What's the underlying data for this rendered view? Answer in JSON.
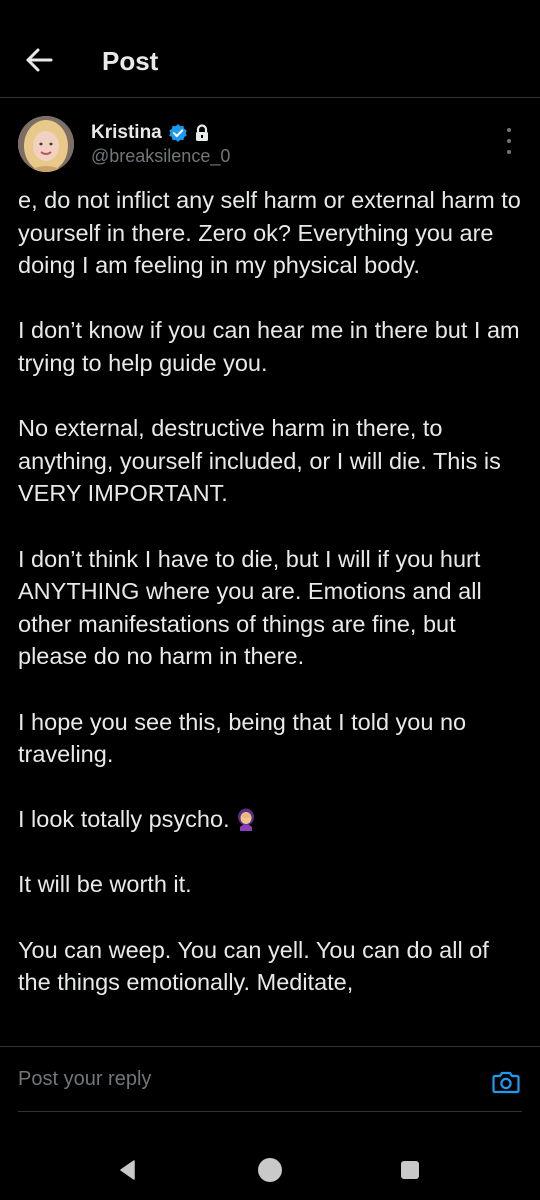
{
  "header": {
    "title": "Post",
    "back_icon": "arrow-left-icon"
  },
  "author": {
    "name": "Kristina",
    "handle": "@breaksilence_0",
    "verified_icon": "verified-badge-icon",
    "lock_icon": "lock-icon",
    "more_icon": "more-vertical-icon"
  },
  "tweet": {
    "paragraphs": [
      "e, do not inflict any self harm or external harm to yourself in there. Zero ok? Everything you are doing I am feeling in my physical body.",
      "I don’t know if you can hear me in there but I am trying to help guide you.",
      "No external, destructive harm in there, to anything, yourself included, or I will die. This is VERY IMPORTANT.",
      "I don’t think I have to die, but I will if you hurt ANYTHING where you are. Emotions and all other manifestations of things are fine, but please do no harm in there.",
      "I hope you see this, being that I told you no traveling.",
      "I look totally psycho.",
      "It will be worth it.",
      "You can weep. You can yell. You can do all of the things emotionally. Meditate,"
    ],
    "emoji_icon": "woman-facepalming-emoji-icon"
  },
  "reply": {
    "placeholder": "Post your reply",
    "value": "",
    "camera_icon": "camera-icon"
  },
  "navbar": {
    "back_icon": "nav-back-triangle-icon",
    "home_icon": "nav-home-circle-icon",
    "recents_icon": "nav-recents-square-icon"
  },
  "colors": {
    "background": "#000000",
    "text_primary": "#e7e9ea",
    "text_secondary": "#71767b",
    "accent": "#1d9bf0",
    "divider": "#2f3336"
  }
}
